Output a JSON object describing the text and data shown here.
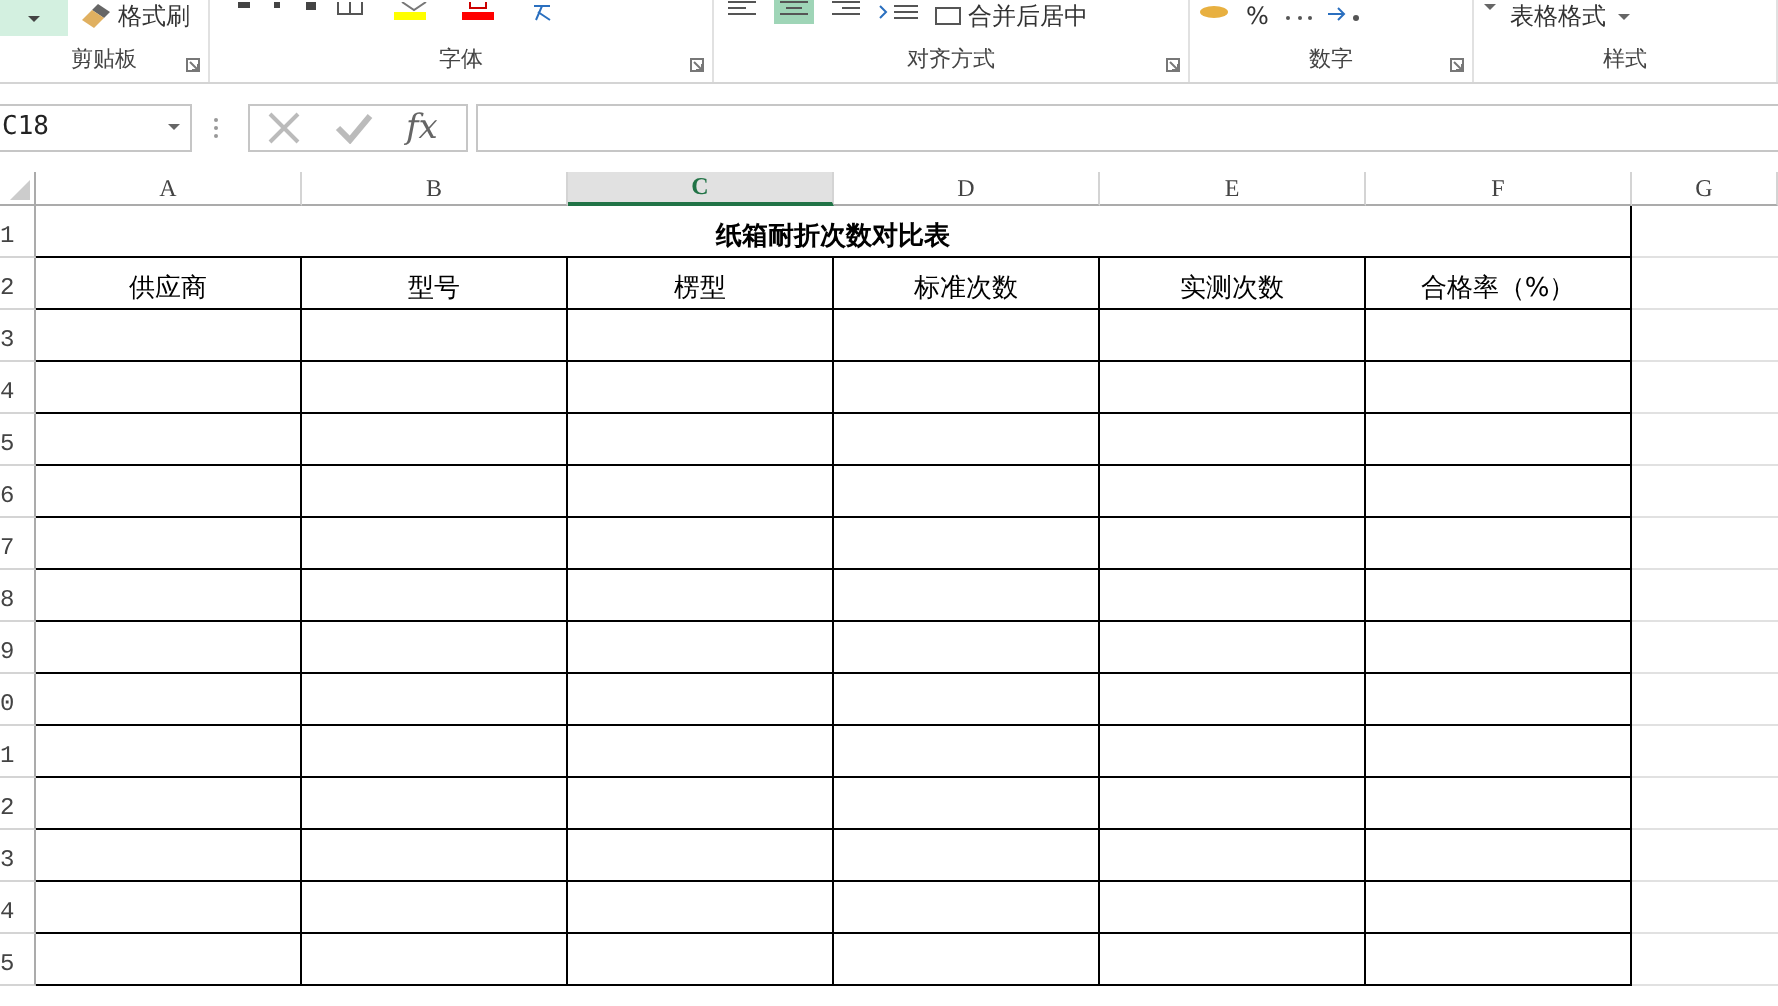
{
  "ribbon": {
    "format_painter": "格式刷",
    "align_buttons": [
      {
        "selected": false
      },
      {
        "selected": true
      },
      {
        "selected": false
      }
    ],
    "merge_center": "合并后居中",
    "percent": "%",
    "table_format": "表格格式",
    "groups": [
      "剪贴板",
      "字体",
      "对齐方式",
      "数字",
      "样式"
    ]
  },
  "formula_bar": {
    "name_box": "C18",
    "fx": "fx"
  },
  "columns": [
    {
      "label": "A",
      "selected": false
    },
    {
      "label": "B",
      "selected": false
    },
    {
      "label": "C",
      "selected": true
    },
    {
      "label": "D",
      "selected": false
    },
    {
      "label": "E",
      "selected": false
    },
    {
      "label": "F",
      "selected": false
    },
    {
      "label": "G",
      "selected": false
    }
  ],
  "row_numbers": [
    "1",
    "2",
    "3",
    "4",
    "5",
    "6",
    "7",
    "8",
    "9",
    "0",
    "1",
    "2",
    "3",
    "4",
    "5"
  ],
  "table": {
    "title": "纸箱耐折次数对比表",
    "headers": [
      "供应商",
      "型号",
      "楞型",
      "标准次数",
      "实测次数",
      "合格率（%）"
    ]
  }
}
